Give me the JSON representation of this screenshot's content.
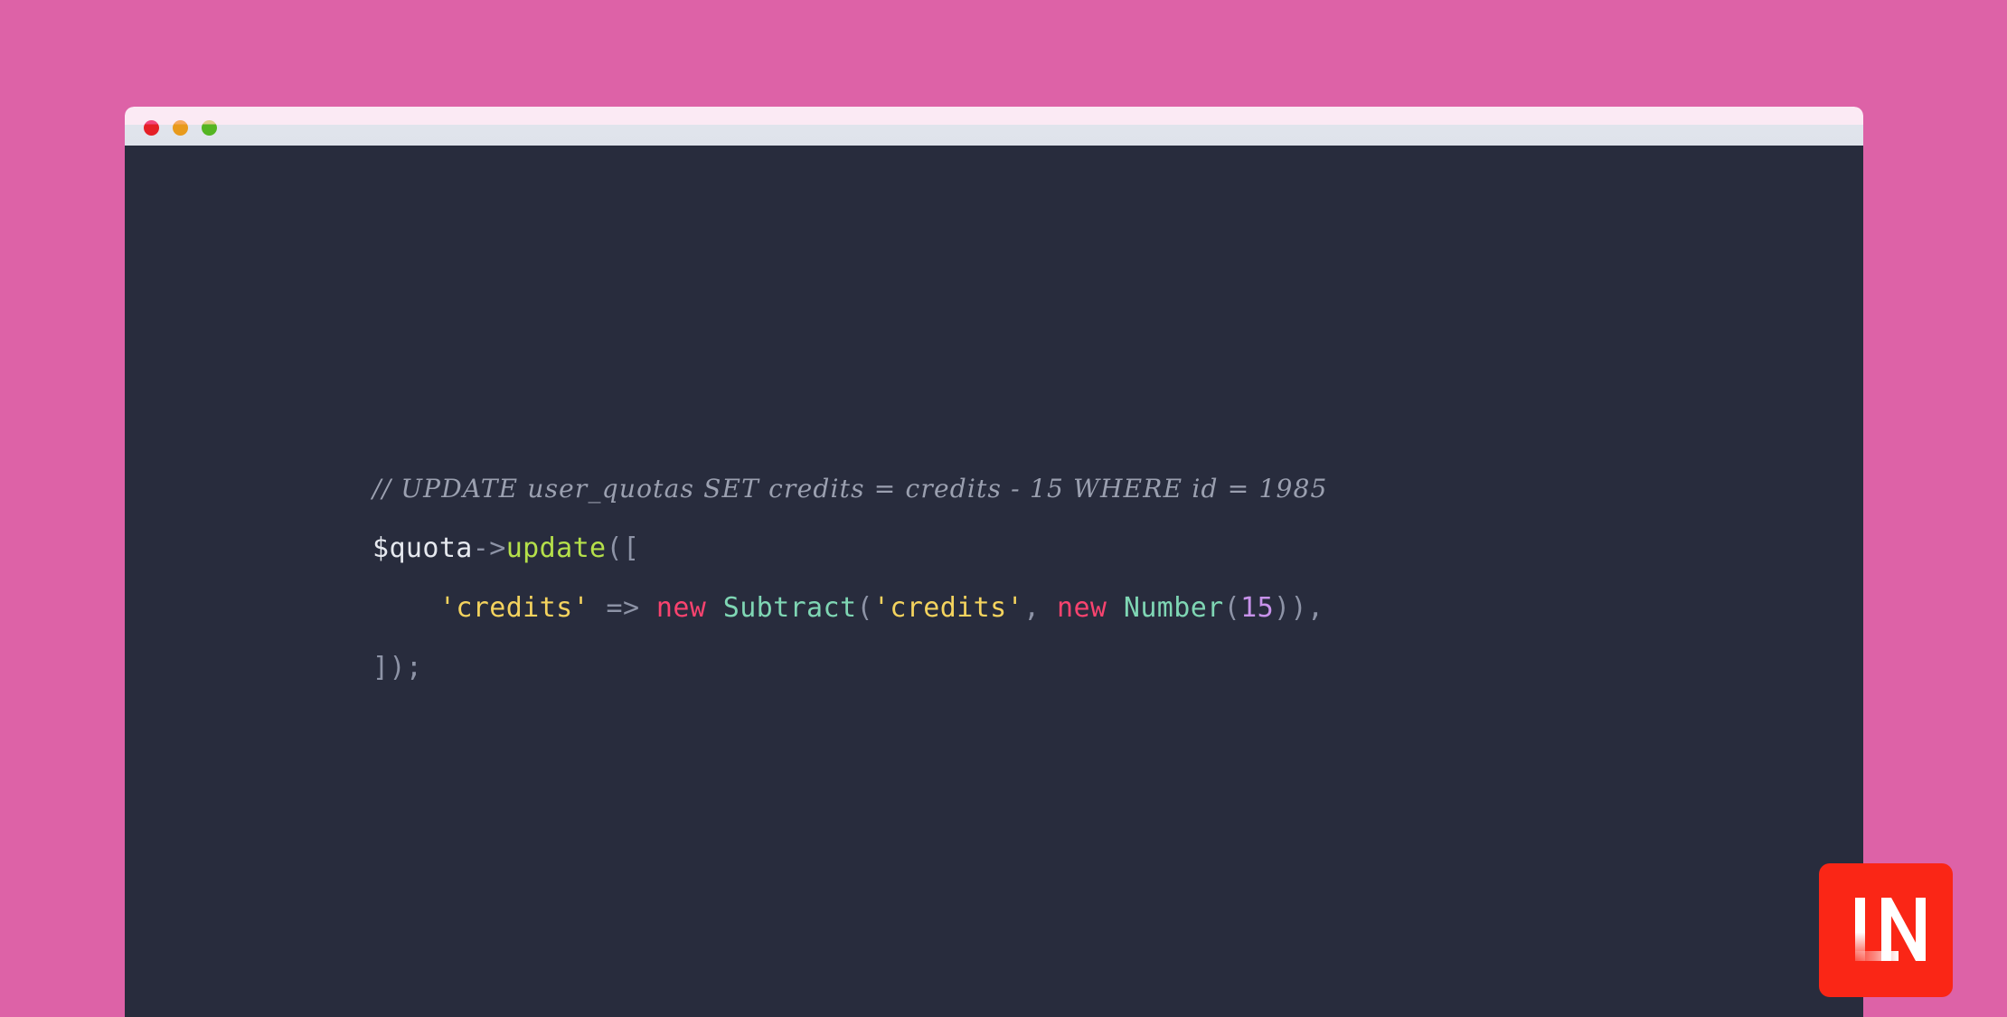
{
  "theme": {
    "page_background": "#dd62a7",
    "editor_background": "#282c3d",
    "titlebar_top": "#fbeaf4",
    "titlebar_bottom": "#e0e4ec",
    "badge_background": "#fa2616",
    "accent_comment": "#9ba0b0",
    "accent_method": "#b5e04a",
    "accent_string": "#f4d35e",
    "accent_keyword": "#f9436f",
    "accent_class": "#7fd6b4",
    "accent_number": "#c792ea",
    "accent_punct": "#8d93a6",
    "accent_plain": "#e6e9ef"
  },
  "window": {
    "traffic_lights": [
      {
        "name": "close-button",
        "color": "#e51f26"
      },
      {
        "name": "minimize-button",
        "color": "#e89a1c"
      },
      {
        "name": "maximize-button",
        "color": "#54b522"
      }
    ]
  },
  "code": {
    "language": "php",
    "raw": "// UPDATE user_quotas SET credits = credits - 15 WHERE id = 1985\n$quota->update([\n    'credits' => new Subtract('credits', new Number(15)),\n]);",
    "lines": [
      {
        "id": "line-1",
        "tokens": [
          {
            "text": "// UPDATE user_quotas SET credits = credits - 15 WHERE id = 1985",
            "type": "comment"
          }
        ]
      },
      {
        "id": "line-2",
        "tokens": [
          {
            "text": "$quota",
            "type": "plain"
          },
          {
            "text": "->",
            "type": "punct"
          },
          {
            "text": "update",
            "type": "method"
          },
          {
            "text": "([",
            "type": "punct"
          }
        ]
      },
      {
        "id": "line-3",
        "tokens": [
          {
            "text": "    ",
            "type": "plain"
          },
          {
            "text": "'credits'",
            "type": "string"
          },
          {
            "text": " => ",
            "type": "punct"
          },
          {
            "text": "new",
            "type": "keyword"
          },
          {
            "text": " ",
            "type": "plain"
          },
          {
            "text": "Subtract",
            "type": "class"
          },
          {
            "text": "(",
            "type": "punct"
          },
          {
            "text": "'credits'",
            "type": "string"
          },
          {
            "text": ", ",
            "type": "punct"
          },
          {
            "text": "new",
            "type": "keyword"
          },
          {
            "text": " ",
            "type": "plain"
          },
          {
            "text": "Number",
            "type": "class"
          },
          {
            "text": "(",
            "type": "punct"
          },
          {
            "text": "15",
            "type": "number"
          },
          {
            "text": ")),",
            "type": "punct"
          }
        ]
      },
      {
        "id": "line-4",
        "tokens": [
          {
            "text": "]);",
            "type": "punct"
          }
        ]
      }
    ]
  },
  "badge": {
    "label": "LN",
    "name": "laravel-news-logo"
  }
}
